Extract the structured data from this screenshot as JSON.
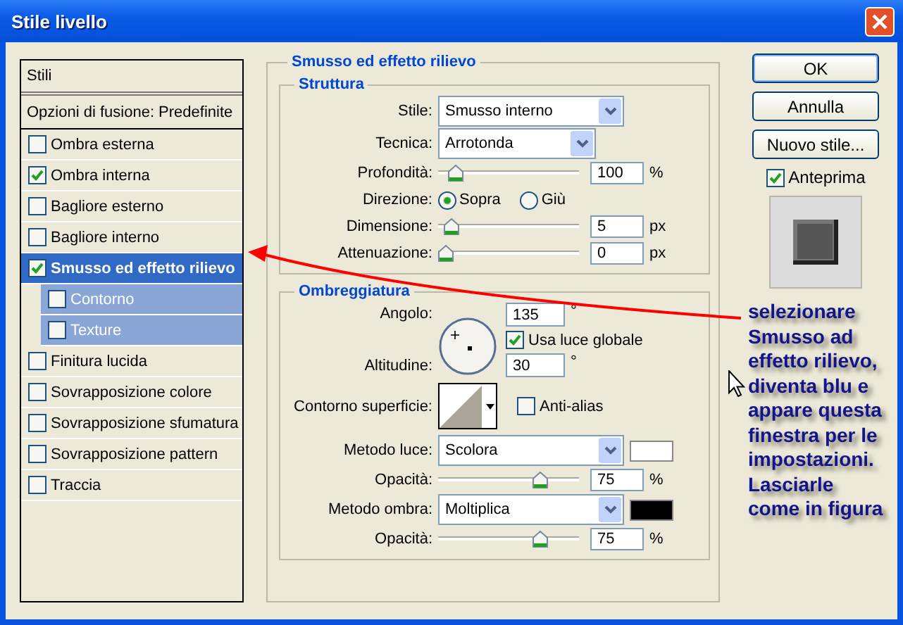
{
  "window": {
    "title": "Stile livello"
  },
  "styles": {
    "header": "Stili",
    "blending": "Opzioni di fusione: Predefinite",
    "items": [
      {
        "label": "Ombra esterna",
        "checked": false,
        "selected": false
      },
      {
        "label": "Ombra interna",
        "checked": true,
        "selected": false
      },
      {
        "label": "Bagliore esterno",
        "checked": false,
        "selected": false
      },
      {
        "label": "Bagliore interno",
        "checked": false,
        "selected": false
      },
      {
        "label": "Smusso ed effetto rilievo",
        "checked": true,
        "selected": true,
        "children": [
          {
            "label": "Contorno",
            "checked": false
          },
          {
            "label": "Texture",
            "checked": false
          }
        ]
      },
      {
        "label": "Finitura lucida",
        "checked": false,
        "selected": false
      },
      {
        "label": "Sovrapposizione colore",
        "checked": false,
        "selected": false
      },
      {
        "label": "Sovrapposizione sfumatura",
        "checked": false,
        "selected": false
      },
      {
        "label": "Sovrapposizione pattern",
        "checked": false,
        "selected": false
      },
      {
        "label": "Traccia",
        "checked": false,
        "selected": false
      }
    ]
  },
  "panel": {
    "title": "Smusso ed effetto rilievo",
    "structure": {
      "title": "Struttura",
      "rows": [
        {
          "kind": "select",
          "label": "Stile:",
          "value": "Smusso interno"
        },
        {
          "kind": "select",
          "label": "Tecnica:",
          "value": "Arrotonda"
        },
        {
          "kind": "slider",
          "label": "Profondità:",
          "level": 0.08,
          "value": "100",
          "unit": "%"
        },
        {
          "kind": "radio",
          "label": "Direzione:",
          "options": [
            {
              "label": "Sopra",
              "selected": true
            },
            {
              "label": "Giù",
              "selected": false
            }
          ]
        },
        {
          "kind": "slider",
          "label": "Dimensione:",
          "level": 0.04,
          "value": "5",
          "unit": "px"
        },
        {
          "kind": "slider",
          "label": "Attenuazione:",
          "level": 0,
          "value": "0",
          "unit": "px"
        }
      ]
    },
    "shading": {
      "title": "Ombreggiatura",
      "rows": [
        {
          "kind": "angle",
          "label": "Angolo:",
          "value": "135",
          "unit": "°",
          "global": {
            "label": "Usa luce globale",
            "checked": true
          },
          "altitude_label": "Altitudine:",
          "altitude": "30",
          "altitude_unit": "°"
        },
        {
          "kind": "contour",
          "label": "Contorno superficie:",
          "antialias": {
            "label": "Anti-alias",
            "checked": false
          }
        },
        {
          "kind": "select",
          "label": "Metodo luce:",
          "value": "Scolora",
          "color": "#ffffff"
        },
        {
          "kind": "slider",
          "label": "Opacità:",
          "level": 0.75,
          "value": "75",
          "unit": "%"
        },
        {
          "kind": "select",
          "label": "Metodo ombra:",
          "value": "Moltiplica",
          "color": "#000000"
        },
        {
          "kind": "slider",
          "label": "Opacità:",
          "level": 0.75,
          "value": "75",
          "unit": "%"
        }
      ]
    }
  },
  "buttons": [
    {
      "label": "OK",
      "default": true
    },
    {
      "label": "Annulla",
      "default": false
    },
    {
      "label": "Nuovo stile...",
      "default": false
    }
  ],
  "preview": {
    "label": "Anteprima",
    "checked": true
  },
  "annotation": "selezionare\nSmusso ad\neffetto rilievo,\ndiventa blu e\nappare questa\nfinestra per le\nimpostazioni.\nLasciarle\ncome in figura"
}
